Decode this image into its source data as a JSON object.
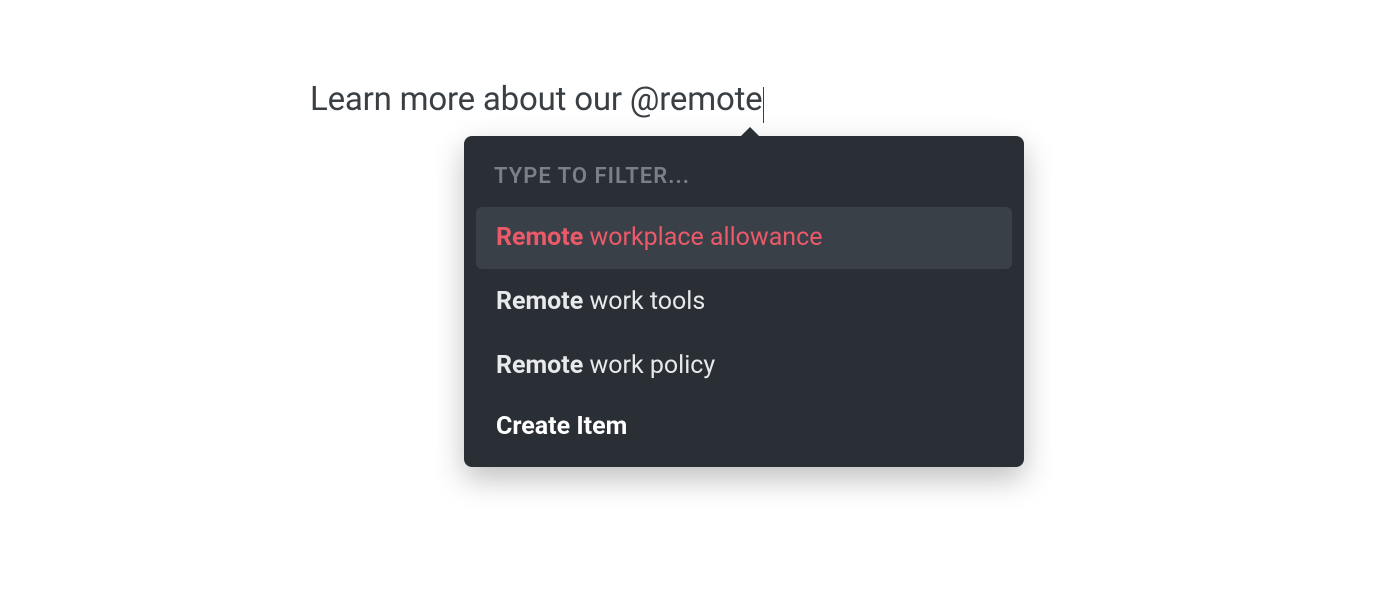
{
  "editor": {
    "prefix_text": "Learn more about our ",
    "mention_text": "@remote"
  },
  "popover": {
    "filter_label": "TYPE TO FILTER...",
    "suggestions": [
      {
        "match": "Remote",
        "rest": " workplace allowance",
        "selected": true
      },
      {
        "match": "Remote",
        "rest": " work tools",
        "selected": false
      },
      {
        "match": "Remote",
        "rest": " work policy",
        "selected": false
      }
    ],
    "create_label": "Create Item"
  }
}
